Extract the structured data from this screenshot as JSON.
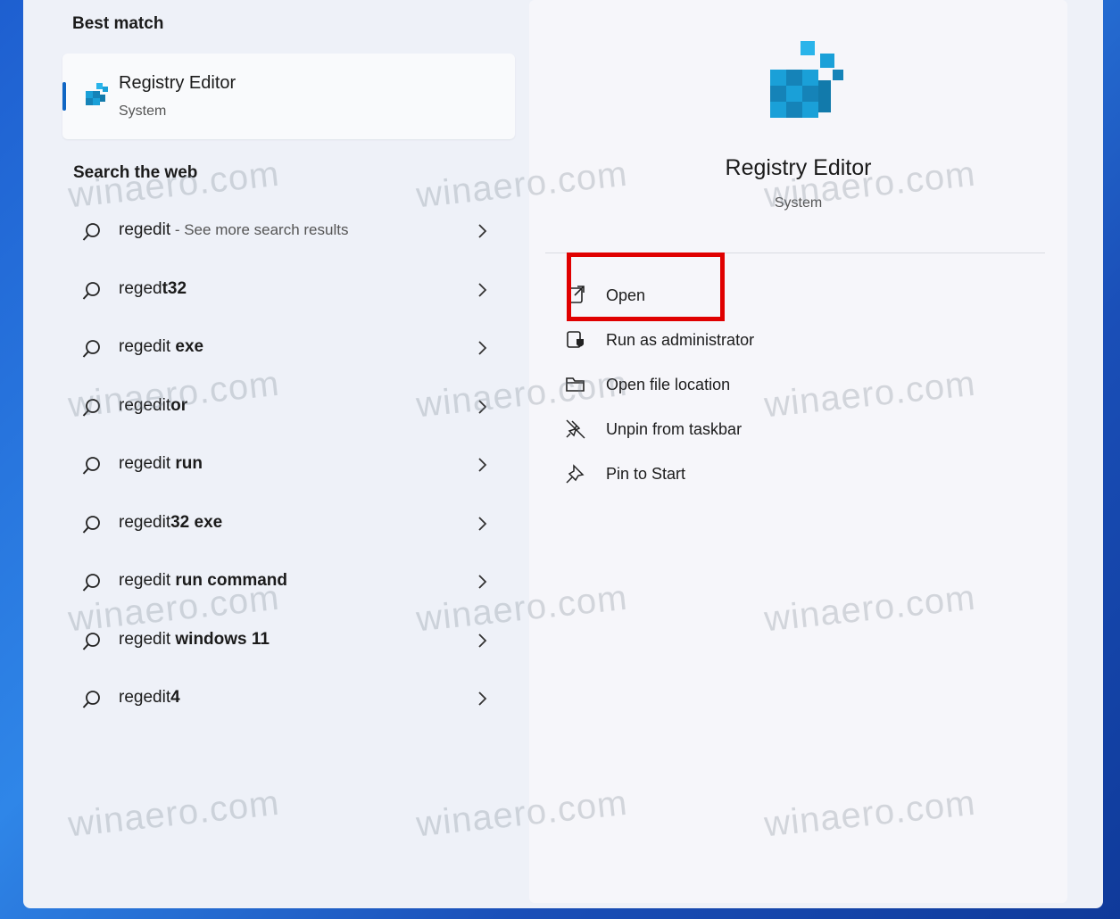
{
  "best_match": {
    "title": "Best match",
    "app_name": "Registry Editor",
    "app_type": "System"
  },
  "web": {
    "title": "Search the web",
    "results": [
      {
        "query": "regedit",
        "hint": " - See more search results"
      },
      {
        "query": "regedt32",
        "hint": ""
      },
      {
        "query": "regedit exe",
        "hint": ""
      },
      {
        "query": "regeditor",
        "hint": ""
      },
      {
        "query": "regedit run",
        "hint": ""
      },
      {
        "query": "regedit32 exe",
        "hint": ""
      },
      {
        "query": "regedit run command",
        "hint": ""
      },
      {
        "query": "regedit windows 11",
        "hint": ""
      },
      {
        "query": "regedit4",
        "hint": ""
      }
    ]
  },
  "details": {
    "app_name": "Registry Editor",
    "app_type": "System",
    "actions": [
      {
        "label": "Open",
        "icon": "open-external-icon"
      },
      {
        "label": "Run as administrator",
        "icon": "shield-admin-icon"
      },
      {
        "label": "Open file location",
        "icon": "folder-icon"
      },
      {
        "label": "Unpin from taskbar",
        "icon": "unpin-icon"
      },
      {
        "label": "Pin to Start",
        "icon": "pin-icon"
      }
    ]
  },
  "watermark": "winaero.com",
  "colors": {
    "accent": "#1066c4",
    "highlight": "#e00000",
    "icon_blue": "#1aa0d8"
  }
}
